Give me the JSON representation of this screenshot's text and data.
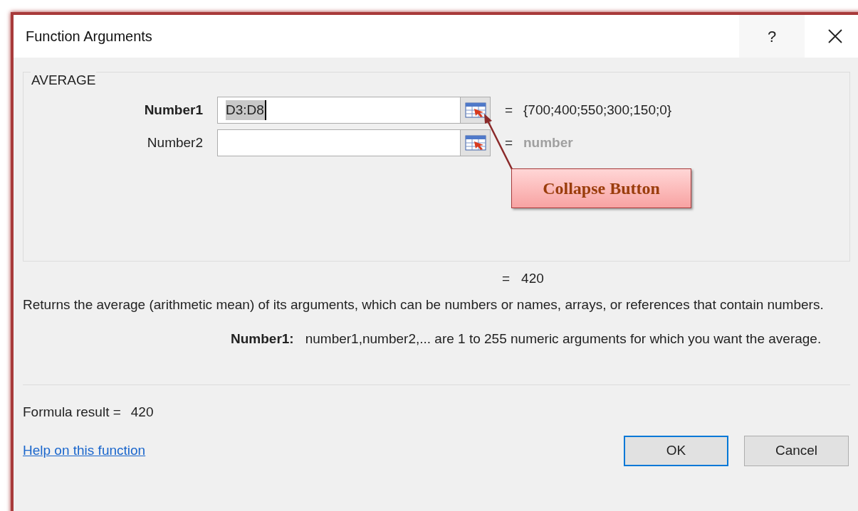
{
  "window": {
    "title": "Function Arguments",
    "help_button": "?"
  },
  "group": {
    "title": "AVERAGE",
    "arguments": [
      {
        "label": "Number1",
        "active": true,
        "value": "D3:D8",
        "equals": "=",
        "result": "{700;400;550;300;150;0}",
        "kind": "value"
      },
      {
        "label": "Number2",
        "active": false,
        "equals": "=",
        "result": "number",
        "kind": "hint"
      }
    ]
  },
  "callout": {
    "text": "Collapse Button"
  },
  "result_line": {
    "equals": "=",
    "value": "420"
  },
  "description": "Returns the average (arithmetic mean) of its arguments, which can be numbers or names, arrays, or references that contain numbers.",
  "argument_help": {
    "label": "Number1:",
    "text": "number1,number2,... are 1 to 255 numeric arguments for which you want the average."
  },
  "formula_result": {
    "label": "Formula result =",
    "value": "420"
  },
  "help_link": "Help on this function",
  "buttons": [
    {
      "label": "OK",
      "default": true
    },
    {
      "label": "Cancel",
      "default": false
    }
  ]
}
